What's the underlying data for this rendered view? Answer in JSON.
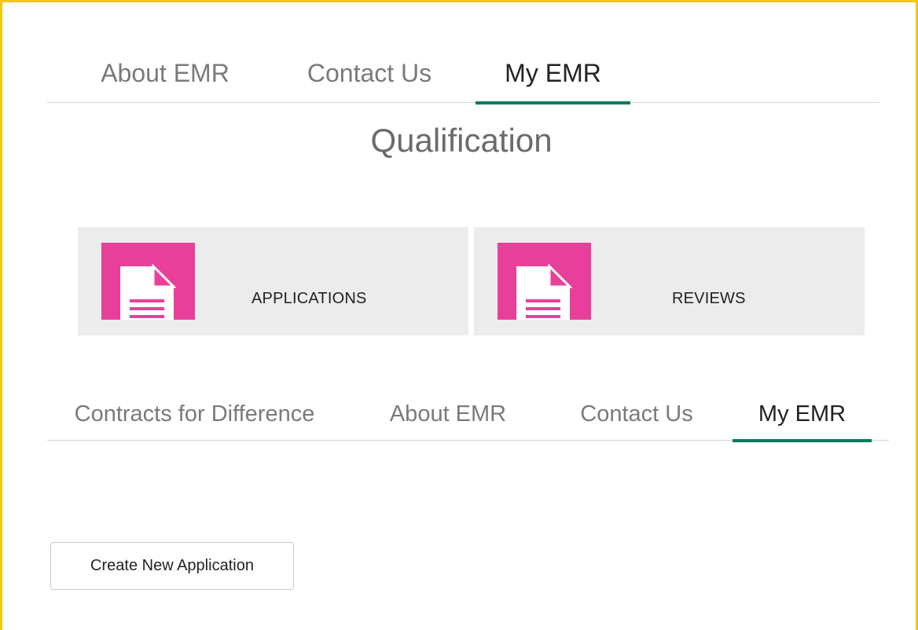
{
  "top_nav": {
    "tabs": [
      {
        "label": "About EMR",
        "active": false
      },
      {
        "label": "Contact Us",
        "active": false
      },
      {
        "label": "My EMR",
        "active": true
      }
    ]
  },
  "page_title": "Qualification",
  "tiles": [
    {
      "label": "APPLICATIONS",
      "icon": "document-icon"
    },
    {
      "label": "REVIEWS",
      "icon": "document-icon"
    }
  ],
  "bottom_nav": {
    "tabs": [
      {
        "label": "Contracts for Difference",
        "active": false
      },
      {
        "label": "About EMR",
        "active": false
      },
      {
        "label": "Contact Us",
        "active": false
      },
      {
        "label": "My EMR",
        "active": true
      }
    ]
  },
  "actions": {
    "create_new_application": "Create New Application"
  },
  "colors": {
    "accent_underline": "#007a5e",
    "tile_icon": "#e8409a",
    "frame_border": "#f5c518"
  }
}
